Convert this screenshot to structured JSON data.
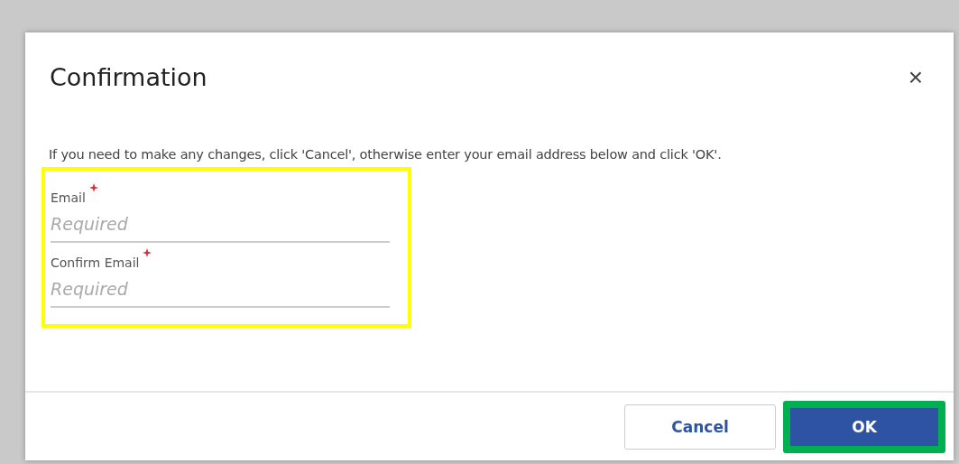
{
  "dialog": {
    "title": "Confirmation",
    "close": "×",
    "message": "If you need to make any changes, click 'Cancel', otherwise enter your email address below and click 'OK'.",
    "fields": [
      {
        "label": "Email",
        "required": true,
        "placeholder": "Required"
      },
      {
        "label": "Confirm Email",
        "required": true,
        "placeholder": "Required"
      }
    ],
    "buttons": [
      {
        "label": "Cancel",
        "kind": "secondary",
        "highlighted": false
      },
      {
        "label": "OK",
        "kind": "primary",
        "highlighted": true
      }
    ]
  }
}
